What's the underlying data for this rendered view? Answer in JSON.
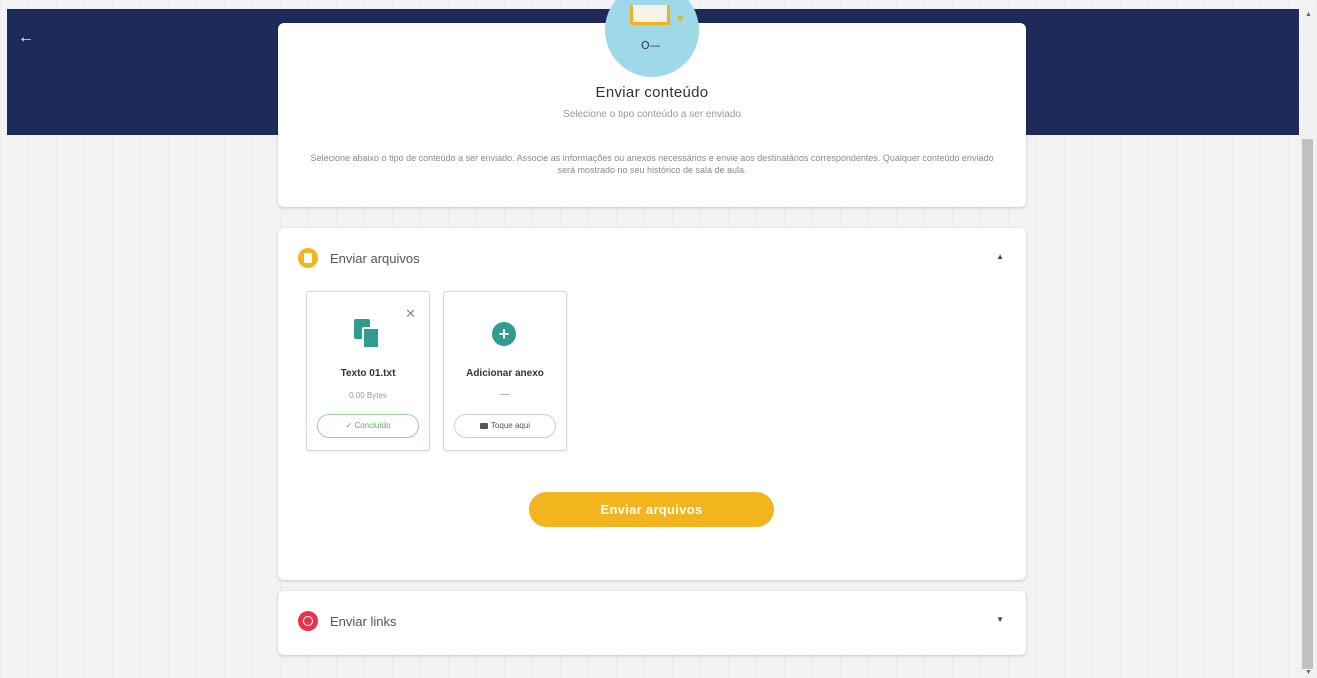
{
  "colors": {
    "header_band": "#1e2a5a",
    "accent_yellow": "#f3b51d",
    "accent_teal": "#2f9c8f",
    "links_icon": "#e8334f",
    "files_icon": "#f3b51d",
    "done_green": "#62a85f"
  },
  "nav": {
    "back_icon": "←"
  },
  "header": {
    "title": "Enviar conteúdo",
    "subtitle": "Selecione o tipo conteúdo a ser enviado",
    "description": "Selecione abaixo o tipo de conteúdo a ser enviado. Associe as informações ou anexos necessários e envie aos destinatários correspondentes. Qualquer conteúdo enviado será mostrado no seu histórico de sala de aula."
  },
  "files_section": {
    "title": "Enviar arquivos",
    "icon": "file-icon",
    "expanded": true,
    "chevron": "▲",
    "tiles": [
      {
        "name": "Texto 01.txt",
        "size": "0.00 Bytes",
        "status": "✓ Concluído",
        "close": "✕"
      },
      {
        "name": "Adicionar anexo",
        "size": "—",
        "action": "Toque aqui"
      }
    ],
    "submit_label": "Enviar arquivos"
  },
  "links_section": {
    "title": "Enviar links",
    "icon": "globe-icon",
    "expanded": false,
    "chevron": "▼"
  }
}
